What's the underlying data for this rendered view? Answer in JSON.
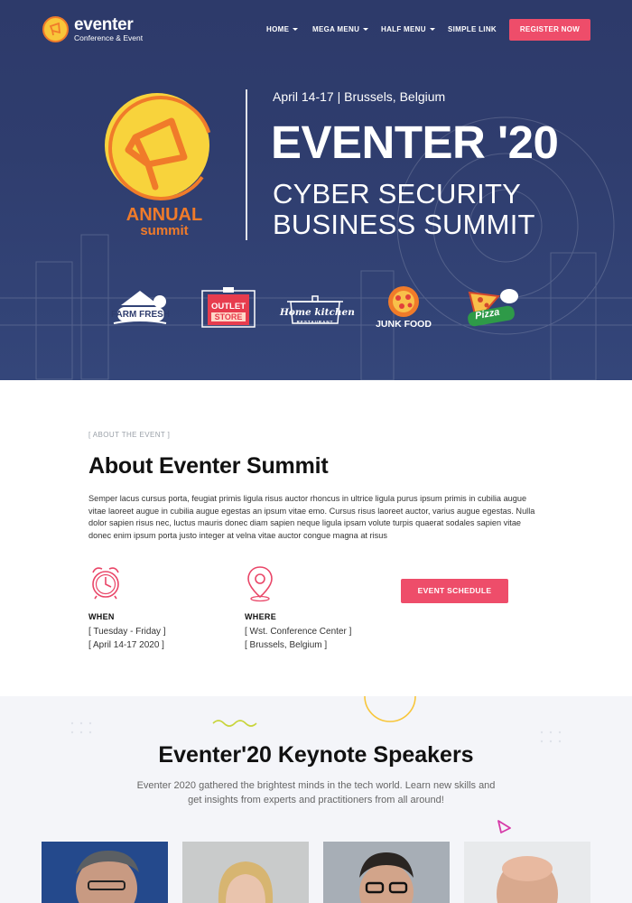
{
  "brand": {
    "name": "eventer",
    "tagline": "Conference & Event"
  },
  "nav": {
    "items": [
      {
        "label": "HOME",
        "dropdown": true
      },
      {
        "label": "MEGA MENU",
        "dropdown": true
      },
      {
        "label": "HALF MENU",
        "dropdown": true
      },
      {
        "label": "SIMPLE LINK",
        "dropdown": false
      }
    ],
    "register_label": "REGISTER NOW"
  },
  "hero": {
    "badge_top": "ANNUAL",
    "badge_bottom": "summit",
    "date_location": "April 14-17 | Brussels, Belgium",
    "title": "EVENTER '20",
    "subtitle_line1": "CYBER SECURITY",
    "subtitle_line2": "BUSINESS SUMMIT"
  },
  "sponsors": [
    {
      "name": "FARM FRESH"
    },
    {
      "name": "OUTLET STORE",
      "line1": "OUTLET",
      "line2": "STORE"
    },
    {
      "name": "Home kitchen",
      "line1": "Home kitchen",
      "line2": "RESTAURANT"
    },
    {
      "name": "JUNK FOOD"
    },
    {
      "name": "Pizza"
    }
  ],
  "about": {
    "eyebrow": "[ ABOUT THE EVENT ]",
    "title": "About Eventer Summit",
    "body": "Semper lacus cursus porta, feugiat primis ligula risus auctor rhoncus in ultrice ligula purus ipsum primis in cubilia augue vitae laoreet augue in cubilia augue egestas an ipsum vitae emo. Cursus risus laoreet auctor, varius augue egestas. Nulla dolor sapien risus nec, luctus mauris donec diam sapien neque ligula ipsam volute turpis quaerat sodales sapien vitae donec enim ipsum porta justo integer at velna vitae auctor congue magna at risus",
    "when": {
      "label": "WHEN",
      "line1": "[ Tuesday - Friday ]",
      "line2": "[ April 14-17 2020 ]",
      "icon": "alarm-clock-icon"
    },
    "where": {
      "label": "WHERE",
      "line1": "[ Wst. Conference Center ]",
      "line2": "[ Brussels, Belgium ]",
      "icon": "map-pin-icon"
    },
    "schedule_label": "EVENT SCHEDULE"
  },
  "speakers": {
    "title": "Eventer'20 Keynote Speakers",
    "text": "Eventer 2020 gathered the brightest minds in the tech world. Learn new skills and get insights from experts and practitioners from all around!",
    "cards": [
      {
        "photo": "speaker-1-photo"
      },
      {
        "photo": "speaker-2-photo"
      },
      {
        "photo": "speaker-3-photo"
      },
      {
        "photo": "speaker-4-photo"
      }
    ]
  },
  "colors": {
    "accent": "#ee4d6a",
    "hero_bg": "#2f3d6e",
    "badge_yellow": "#f8d33c",
    "badge_orange": "#f07b2a"
  }
}
